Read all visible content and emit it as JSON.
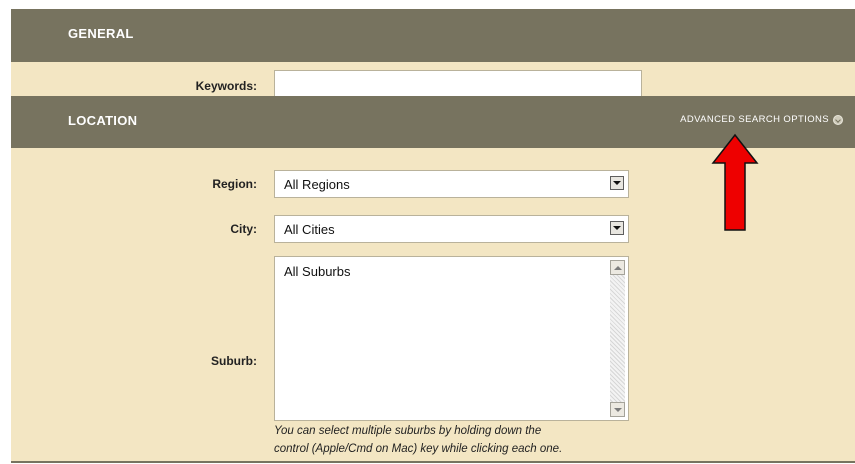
{
  "general": {
    "title": "GENERAL",
    "keywords_label": "Keywords:",
    "keywords_value": ""
  },
  "location": {
    "title": "LOCATION",
    "advanced_link": "ADVANCED SEARCH OPTIONS",
    "advanced_icon": "chevron-down-icon",
    "region_label": "Region:",
    "region_value": "All Regions",
    "city_label": "City:",
    "city_value": "All Cities",
    "suburb_label": "Suburb:",
    "suburb_options": [
      "All Suburbs"
    ],
    "suburb_hint_line1": "You can select multiple suburbs by holding down the",
    "suburb_hint_line2": "control (Apple/Cmd on Mac) key while clicking each one."
  },
  "annotation": {
    "arrow_color": "#ee0000",
    "arrow_icon": "arrow-up-icon"
  },
  "colors": {
    "header_bg": "#77735f",
    "panel_bg": "#f3e6c3"
  }
}
